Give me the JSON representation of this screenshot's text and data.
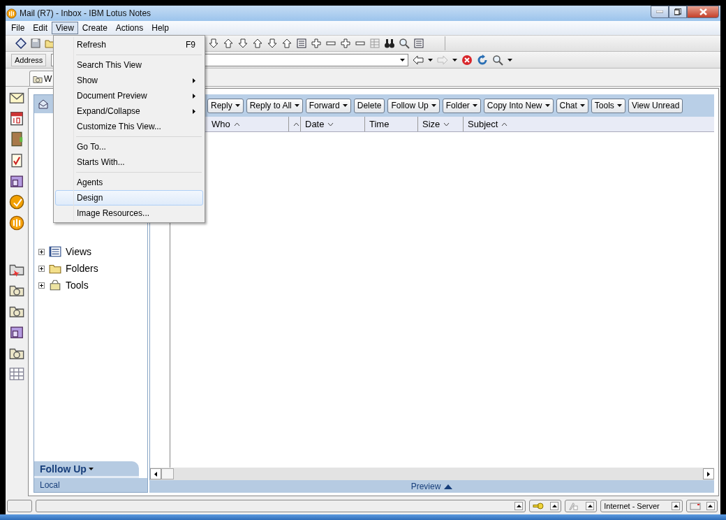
{
  "window": {
    "title": "Mail (R7) - Inbox - IBM Lotus Notes"
  },
  "menu_bar": [
    {
      "label": "File",
      "selected": false
    },
    {
      "label": "Edit",
      "selected": false
    },
    {
      "label": "View",
      "selected": true
    },
    {
      "label": "Create",
      "selected": false
    },
    {
      "label": "Actions",
      "selected": false
    },
    {
      "label": "Help",
      "selected": false
    }
  ],
  "view_menu": [
    {
      "kind": "item",
      "label": "Refresh",
      "shortcut": "F9",
      "submenu": false,
      "selected": false
    },
    {
      "kind": "separator"
    },
    {
      "kind": "item",
      "label": "Search This View",
      "submenu": false,
      "selected": false
    },
    {
      "kind": "item",
      "label": "Show",
      "submenu": true,
      "selected": false
    },
    {
      "kind": "item",
      "label": "Document Preview",
      "submenu": true,
      "selected": false
    },
    {
      "kind": "item",
      "label": "Expand/Collapse",
      "submenu": true,
      "selected": false
    },
    {
      "kind": "item",
      "label": "Customize This View...",
      "submenu": false,
      "selected": false
    },
    {
      "kind": "separator"
    },
    {
      "kind": "item",
      "label": "Go To...",
      "submenu": false,
      "selected": false
    },
    {
      "kind": "item",
      "label": "Starts With...",
      "submenu": false,
      "selected": false
    },
    {
      "kind": "separator"
    },
    {
      "kind": "item",
      "label": "Agents",
      "submenu": false,
      "selected": false
    },
    {
      "kind": "item",
      "label": "Design",
      "submenu": false,
      "selected": true
    },
    {
      "kind": "item",
      "label": "Image Resources...",
      "submenu": false,
      "selected": false
    }
  ],
  "address_bar": {
    "label": "Address"
  },
  "open_tab": {
    "label": "W"
  },
  "navigator": {
    "tree": [
      {
        "label": "Views",
        "expanded": false
      },
      {
        "label": "Folders",
        "expanded": false
      },
      {
        "label": "Tools",
        "expanded": false
      }
    ],
    "footer_tab": "Follow Up",
    "location": "Local"
  },
  "action_bar": [
    {
      "label": "Reply",
      "dropdown": true
    },
    {
      "label": "Reply to All",
      "dropdown": true
    },
    {
      "label": "Forward",
      "dropdown": true
    },
    {
      "label": "Delete",
      "dropdown": false
    },
    {
      "label": "Follow Up",
      "dropdown": true
    },
    {
      "label": "Folder",
      "dropdown": true
    },
    {
      "label": "Copy Into New",
      "dropdown": true
    },
    {
      "label": "Chat",
      "dropdown": true
    },
    {
      "label": "Tools",
      "dropdown": true
    },
    {
      "label": "View Unread",
      "dropdown": false
    }
  ],
  "columns": [
    {
      "label": "Who",
      "ascending": true
    },
    {
      "ascending": true
    },
    {
      "label": "Date",
      "ascending": false
    },
    {
      "label": "Time"
    },
    {
      "label": "Size",
      "ascending": false
    },
    {
      "label": "Subject",
      "ascending": true
    }
  ],
  "preview_bar": {
    "label": "Preview"
  },
  "status_bar": {
    "location": "Internet - Server"
  }
}
